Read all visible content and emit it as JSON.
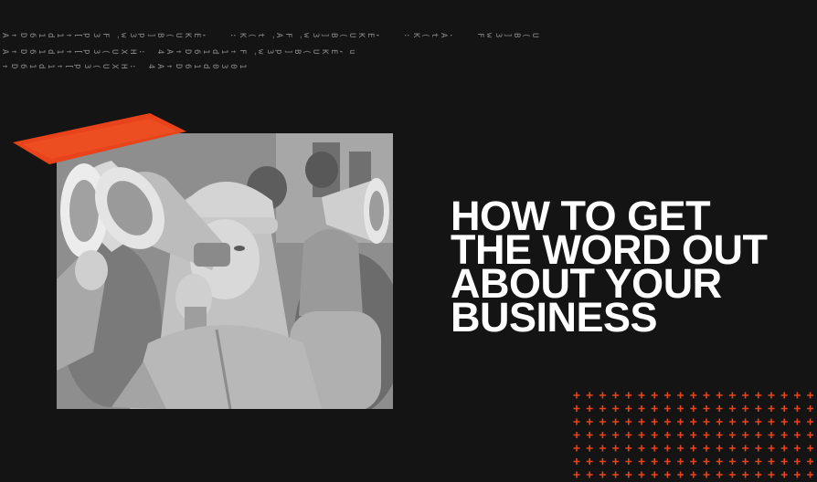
{
  "headline": {
    "lines": [
      "HOW TO GET",
      "THE WORD OUT",
      "ABOUT YOUR",
      "BUSINESS"
    ]
  },
  "decor": {
    "glyph_row_1": "A↑D61d1↑[p3F̄w3p]B⟨UKE,  :K⟨t̄AF̄w3]B⟨UKE,  :K⟨tA.  Fw3]B⟨U",
    "glyph_row_2": "A↑D61d1↑[p3⟨UXH: 4A↑D61d1↑F̄w3p]B⟨UKE,u",
    "glyph_row_3": "↑D61d1↑[p3⟨UXH: 4A↑D61d0301"
  },
  "colors": {
    "background": "#141414",
    "accent": "#e8431a",
    "text": "#ffffff"
  }
}
